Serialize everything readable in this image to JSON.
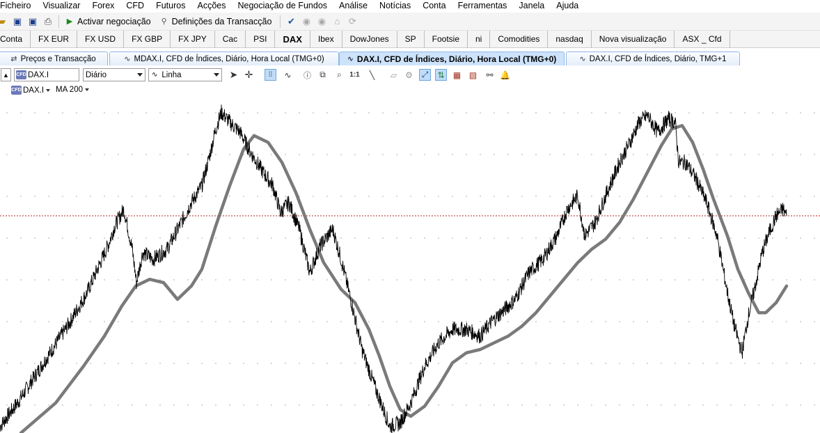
{
  "menu": [
    "Ficheiro",
    "Visualizar",
    "Forex",
    "CFD",
    "Futuros",
    "Acções",
    "Negociação de Fundos",
    "Análise",
    "Notícias",
    "Conta",
    "Ferramentas",
    "Janela",
    "Ajuda"
  ],
  "toolbar": {
    "activate_label": "Activar negociação",
    "settings_label": "Definições da Transacção"
  },
  "workspace_tabs": [
    {
      "label": "Conta",
      "active": false
    },
    {
      "label": "FX EUR",
      "active": false
    },
    {
      "label": "FX USD",
      "active": false
    },
    {
      "label": "FX GBP",
      "active": false
    },
    {
      "label": "FX JPY",
      "active": false
    },
    {
      "label": "Cac",
      "active": false
    },
    {
      "label": "PSI",
      "active": false
    },
    {
      "label": "DAX",
      "active": true
    },
    {
      "label": "Ibex",
      "active": false
    },
    {
      "label": "DowJones",
      "active": false
    },
    {
      "label": "SP",
      "active": false
    },
    {
      "label": "Footsie",
      "active": false
    },
    {
      "label": "ni",
      "active": false
    },
    {
      "label": "Comodities",
      "active": false
    },
    {
      "label": "nasdaq",
      "active": false
    },
    {
      "label": "Nova visualização",
      "active": false
    },
    {
      "label": "ASX _ Cfd",
      "active": false
    }
  ],
  "chart_tabs": [
    {
      "label": "Preços e Transacção",
      "active": false
    },
    {
      "label": "MDAX.I, CFD de Índices, Diário, Hora Local (TMG+0)",
      "active": false
    },
    {
      "label": "DAX.I, CFD de Índices, Diário, Hora Local (TMG+0)",
      "active": true
    },
    {
      "label": "DAX.I, CFD de Índices, Diário, TMG+1",
      "active": false
    }
  ],
  "chart_toolbar": {
    "symbol": "DAX.I",
    "cfd_chip": "CFD",
    "timeframe": "Diário",
    "chart_style": "Linha"
  },
  "legend": {
    "instrument": "DAX.I",
    "indicator": "MA 200"
  },
  "colors": {
    "price_line": "#000000",
    "ma_line": "#7a7a7a",
    "current_price_line": "#b02020",
    "active_tab": "#cde3fb"
  },
  "chart_data": {
    "type": "line",
    "title": "",
    "xlabel": "",
    "ylabel": "",
    "grid": true,
    "series": [
      {
        "name": "DAX.I",
        "x": [
          0,
          25,
          50,
          75,
          100,
          125,
          140,
          155,
          165,
          178,
          190,
          196,
          205,
          220,
          240,
          258,
          275,
          290,
          300,
          310,
          318,
          330,
          345,
          360,
          378,
          392,
          403,
          415,
          430,
          445,
          460,
          478,
          490,
          505,
          520,
          540,
          560,
          575,
          590,
          610,
          630,
          650,
          670,
          690,
          705,
          720,
          740,
          760,
          780,
          800,
          815,
          830,
          840,
          855,
          870,
          890,
          905,
          918,
          930,
          945,
          960,
          970,
          975,
          985,
          1000,
          1015,
          1030,
          1045,
          1055,
          1066,
          1075,
          1085,
          1095,
          1105,
          1115,
          1125,
          1130
        ],
        "y": [
          1.0,
          4.5,
          8.5,
          12.5,
          16.5,
          21.0,
          24.5,
          28.0,
          31.0,
          33.5,
          27.5,
          22.5,
          27.0,
          26.0,
          27.5,
          31.0,
          34.5,
          37.0,
          41.0,
          45.5,
          48.0,
          46.5,
          45.0,
          42.0,
          39.0,
          37.0,
          33.0,
          34.5,
          30.5,
          24.0,
          28.0,
          30.5,
          26.0,
          19.5,
          12.5,
          6.5,
          1.0,
          1.5,
          4.5,
          10.0,
          13.5,
          15.5,
          15.5,
          14.5,
          16.5,
          18.0,
          20.0,
          24.0,
          26.0,
          29.5,
          33.5,
          35.5,
          29.5,
          31.5,
          35.5,
          40.5,
          43.5,
          46.5,
          47.5,
          45.0,
          47.0,
          46.5,
          40.5,
          40.5,
          38.0,
          34.5,
          29.5,
          21.0,
          16.0,
          12.0,
          17.5,
          22.0,
          27.0,
          30.0,
          32.5,
          33.5,
          32.5
        ]
      },
      {
        "name": "MA 200",
        "x": [
          30,
          80,
          120,
          150,
          175,
          195,
          215,
          235,
          255,
          275,
          290,
          310,
          330,
          350,
          365,
          385,
          405,
          425,
          445,
          465,
          490,
          510,
          530,
          545,
          560,
          575,
          590,
          610,
          630,
          650,
          670,
          690,
          710,
          730,
          750,
          770,
          790,
          810,
          830,
          850,
          870,
          890,
          910,
          930,
          950,
          965,
          980,
          995,
          1010,
          1025,
          1045,
          1060,
          1075,
          1090,
          1100,
          1115,
          1130
        ],
        "y": [
          0.0,
          4.5,
          10.0,
          14.5,
          19.0,
          22.0,
          23.0,
          22.5,
          20.0,
          22.0,
          24.5,
          31.0,
          37.0,
          42.5,
          44.5,
          43.5,
          40.5,
          36.0,
          30.5,
          25.5,
          21.5,
          19.5,
          15.5,
          11.5,
          7.0,
          3.5,
          2.5,
          4.0,
          7.0,
          10.5,
          12.0,
          12.5,
          13.5,
          14.5,
          16.0,
          18.0,
          20.5,
          23.0,
          25.5,
          27.5,
          29.0,
          31.5,
          35.0,
          39.0,
          43.0,
          45.5,
          46.0,
          43.5,
          39.5,
          35.0,
          29.5,
          24.5,
          21.0,
          18.0,
          18.0,
          19.5,
          22.0
        ]
      }
    ],
    "current_price": 32.5
  }
}
